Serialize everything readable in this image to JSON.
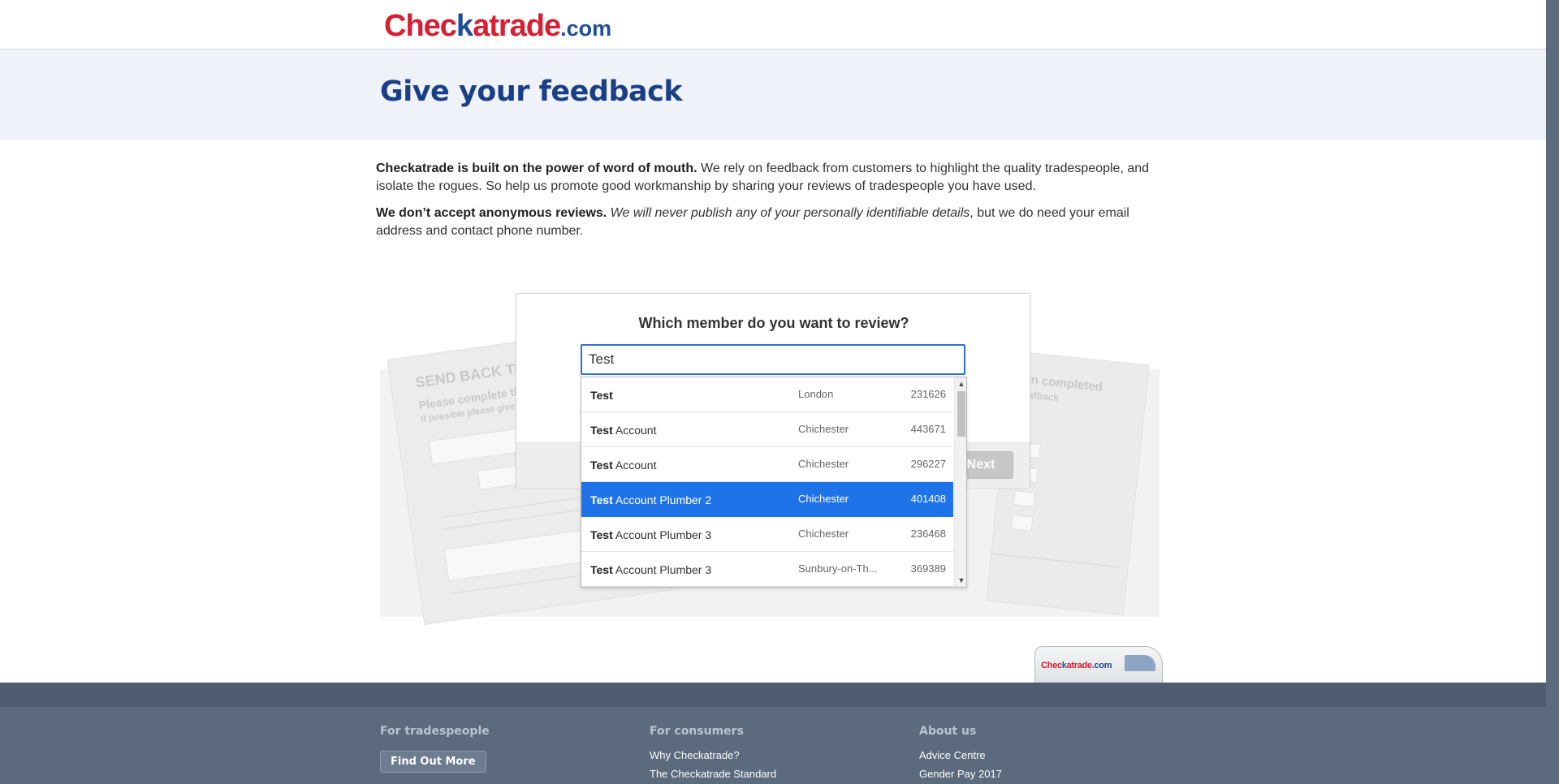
{
  "header": {
    "logo_part1": "Chec",
    "logo_part2": "k",
    "logo_part3": "atrade",
    "logo_domain": ".com"
  },
  "hero": {
    "title": "Give your feedback"
  },
  "intro": {
    "p1_bold": "Checkatrade is built on the power of word of mouth.",
    "p1_text": " We rely on feedback from customers to highlight the quality tradespeople, and isolate the rogues. So help us promote good workmanship by sharing your reviews of tradespeople you have used.",
    "p2_bold": "We don’t accept anonymous reviews.",
    "p2_italic": " We will never publish any of your personally identifiable details",
    "p2_text": ", but we do need your email address and contact phone number."
  },
  "modal": {
    "question": "Which member do you want to review?",
    "search_value": "Test",
    "next_label": "Next"
  },
  "results": [
    {
      "match": "Test",
      "rest": "",
      "location": "London",
      "id": "231626",
      "selected": false
    },
    {
      "match": "Test",
      "rest": " Account",
      "location": "Chichester",
      "id": "443671",
      "selected": false
    },
    {
      "match": "Test",
      "rest": " Account",
      "location": "Chichester",
      "id": "296227",
      "selected": false
    },
    {
      "match": "Test",
      "rest": " Account Plumber 2",
      "location": "Chichester",
      "id": "401408",
      "selected": true
    },
    {
      "match": "Test",
      "rest": " Account Plumber 3",
      "location": "Chichester",
      "id": "236468",
      "selected": false
    },
    {
      "match": "Test",
      "rest": " Account Plumber 3",
      "location": "Sunbury-on-Th...",
      "id": "369389",
      "selected": false
    }
  ],
  "background_form": {
    "heading_left": "SEND BACK TO C",
    "sub_left": "Please complete th",
    "sub_left2": "If possible please give",
    "heading_right": "been completed",
    "sub_right": "eFeedback"
  },
  "van": {
    "logo_part1": "Chec",
    "logo_part2": "k",
    "logo_part3": "atrade",
    "logo_domain": ".com"
  },
  "footer": {
    "col1_title": "For tradespeople",
    "col1_button": "Find Out More",
    "col2_title": "For consumers",
    "col2_links": [
      "Why Checkatrade?",
      "The Checkatrade Standard"
    ],
    "col3_title": "About us",
    "col3_links": [
      "Advice Centre",
      "Gender Pay 2017"
    ]
  },
  "colors": {
    "brand_red": "#d71e33",
    "brand_blue": "#1b4e9b",
    "title_blue": "#1a3f87",
    "selection_blue": "#1f73e8",
    "footer_bg": "#5c6a7e"
  }
}
